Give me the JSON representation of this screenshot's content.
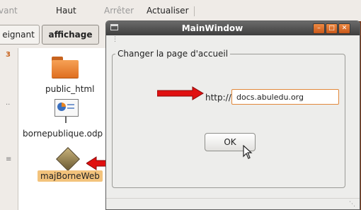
{
  "toolbar": {
    "back_label": "vant",
    "up_label": "Haut",
    "stop_label": "Arrêter",
    "reload_label": "Actualiser"
  },
  "tabs": [
    {
      "label": "eignant"
    },
    {
      "label": "affichage"
    }
  ],
  "side_indicators": [
    "3",
    "..",
    "≡"
  ],
  "files": [
    {
      "name": "public_html",
      "icon": "folder-icon"
    },
    {
      "name": "bornepublique.odp",
      "icon": "presentation-icon"
    },
    {
      "name": "majBorneWeb",
      "icon": "executable-icon",
      "selected": true
    }
  ],
  "window": {
    "title": "MainWindow",
    "buttons": [
      "minimize-icon",
      "maximize-icon",
      "close-icon"
    ],
    "group_title": "Changer la page d'accueil",
    "url_prefix": "http://",
    "url_value": "docs.abuledu.org",
    "ok_label": "OK"
  },
  "colors": {
    "titlebar": "#4e4e4e",
    "accent_orange": "#e2883a",
    "arrow_red": "#e01010",
    "selection": "#f3c37c",
    "desktop_brown": "#7a3b1c"
  }
}
